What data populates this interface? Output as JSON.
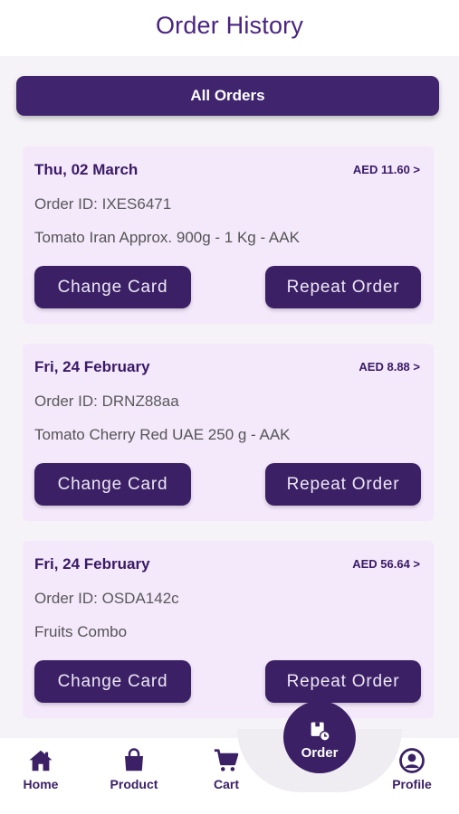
{
  "header": {
    "title": "Order History"
  },
  "filter": {
    "label": "All Orders"
  },
  "orders": [
    {
      "date": "Thu, 02 March",
      "amount": "AED 11.60 >",
      "order_id": "Order ID: IXES6471",
      "product": "Tomato Iran Approx.  900g - 1 Kg - AAK",
      "change_label": "Change Card",
      "repeat_label": "Repeat Order"
    },
    {
      "date": "Fri, 24 February",
      "amount": "AED 8.88 >",
      "order_id": "Order ID: DRNZ88aa",
      "product": "Tomato Cherry Red UAE 250 g - AAK",
      "change_label": "Change Card",
      "repeat_label": "Repeat Order"
    },
    {
      "date": "Fri, 24 February",
      "amount": "AED 56.64 >",
      "order_id": "Order ID: OSDA142c",
      "product": "Fruits Combo",
      "change_label": "Change Card",
      "repeat_label": "Repeat Order"
    }
  ],
  "nav": {
    "items": [
      {
        "label": "Home",
        "icon": "home-icon"
      },
      {
        "label": "Product",
        "icon": "bag-icon"
      },
      {
        "label": "Cart",
        "icon": "cart-icon"
      },
      {
        "label": "Order",
        "icon": "order-box-icon"
      },
      {
        "label": "Profile",
        "icon": "profile-icon"
      }
    ]
  },
  "colors": {
    "primary": "#3b2065",
    "title": "#4a2480",
    "card_bg": "#f4e8fb",
    "page_bg": "#f5f3f7"
  }
}
